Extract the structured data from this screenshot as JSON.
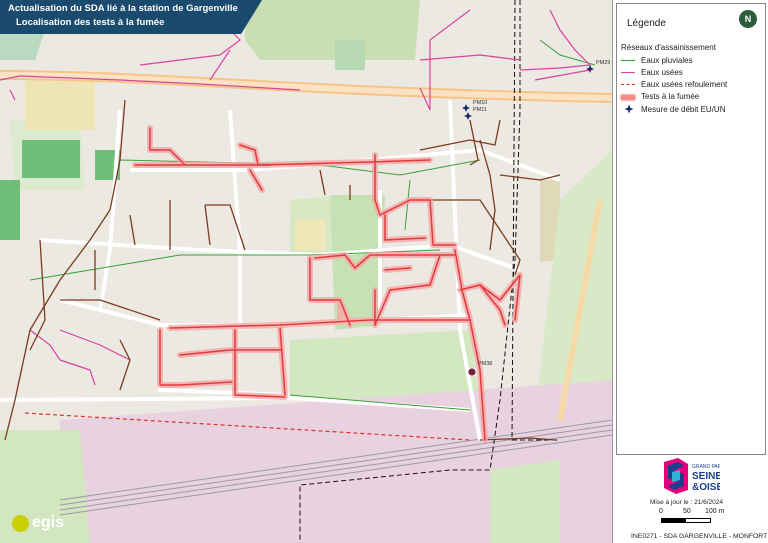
{
  "title": {
    "line1": "Actualisation du SDA lié à la station de Gargenville",
    "line2": "Localisation des tests à la fumée"
  },
  "legend": {
    "title": "Légende",
    "north_label": "N",
    "group": "Réseaux d'assainissement",
    "items": [
      {
        "label": "Eaux pluviales",
        "color": "#3aa23a",
        "style": "solid"
      },
      {
        "label": "Eaux usées",
        "color": "#d9449b",
        "style": "solid"
      },
      {
        "label": "Eaux usées refoulement",
        "color": "#e0302a",
        "style": "dashed"
      },
      {
        "label": "Tests à la fumée",
        "color": "#f28a8a",
        "style": "thick"
      },
      {
        "label": "Mesure de débit EU/UN",
        "color": "#1c2a6b",
        "style": "star"
      }
    ]
  },
  "measurement_points": [
    {
      "id": "PM29"
    },
    {
      "id": "PM10"
    },
    {
      "id": "PM11"
    },
    {
      "id": "PM38"
    }
  ],
  "footer": {
    "update": "Mise à jour le : 21/6/2024",
    "scale": {
      "zero": "0",
      "mid": "50",
      "end": "100 m"
    },
    "reference": "INE0271 - SDA GARGENVILLE - MONFORT",
    "company": "egis"
  },
  "colors": {
    "title_bg": "#1a4a6e",
    "smoke": "#ee3b3b",
    "pluvial": "#3aa23a",
    "usees": "#d9449b",
    "refoulement": "#e0302a",
    "unitaire": "#7a3b1f"
  }
}
